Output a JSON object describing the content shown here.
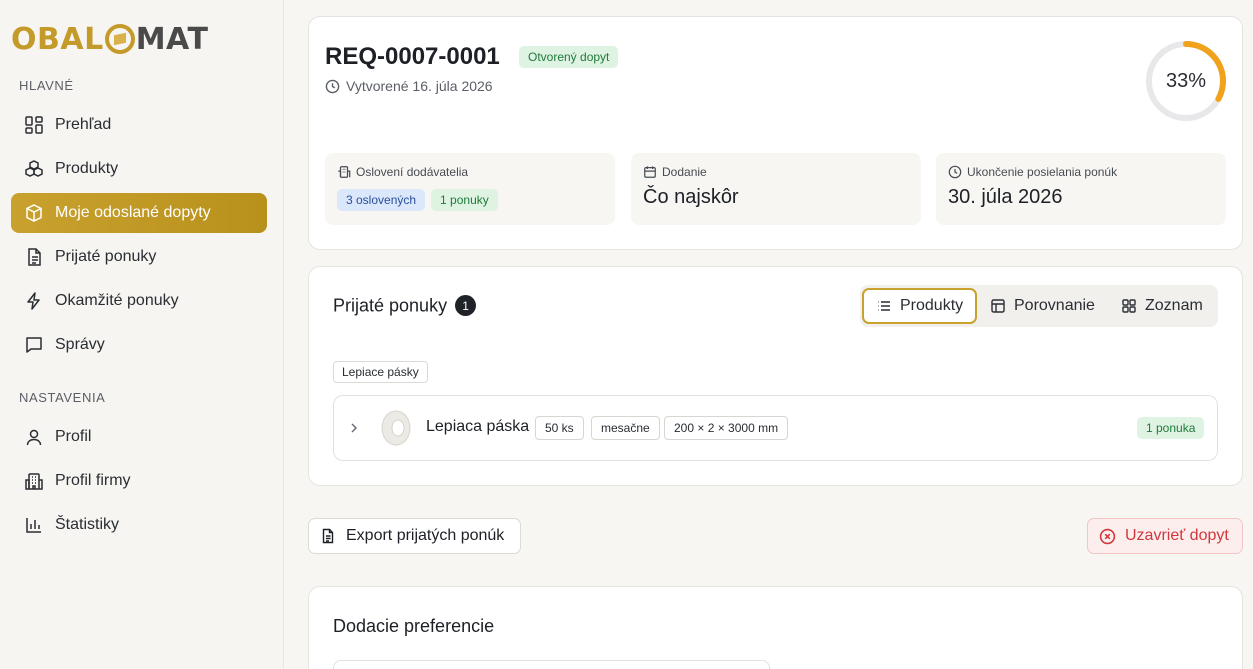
{
  "brand": {
    "logo_left": "OBAL",
    "logo_right": "MAT"
  },
  "sidebar": {
    "section_main": "HLAVNÉ",
    "section_settings": "NASTAVENIA",
    "items": [
      {
        "label": "Prehľad",
        "icon": "dashboard-icon"
      },
      {
        "label": "Produkty",
        "icon": "boxes-icon"
      },
      {
        "label": "Moje odoslané dopyty",
        "icon": "package-send-icon",
        "active": true
      },
      {
        "label": "Prijaté ponuky",
        "icon": "document-icon"
      },
      {
        "label": "Okamžité ponuky",
        "icon": "lightning-icon"
      },
      {
        "label": "Správy",
        "icon": "message-icon"
      }
    ],
    "settings_items": [
      {
        "label": "Profil",
        "icon": "user-icon"
      },
      {
        "label": "Profil firmy",
        "icon": "building-icon"
      },
      {
        "label": "Štatistiky",
        "icon": "bar-chart-icon"
      }
    ]
  },
  "request": {
    "id": "REQ-0007-0001",
    "status": "Otvorený dopyt",
    "created": "Vytvorené 16. júla 2026",
    "progress_percent": 33,
    "progress_label": "33%",
    "accent_color": "#f0a21a",
    "suppliers": {
      "label": "Oslovení dodávatelia",
      "contacted": "3 oslovených",
      "offers": "1 ponuky"
    },
    "delivery": {
      "label": "Dodanie",
      "value": "Čo najskôr"
    },
    "deadline": {
      "label": "Ukončenie posielania ponúk",
      "value": "30. júla 2026"
    }
  },
  "offers": {
    "title": "Prijaté ponuky",
    "count": "1",
    "views": [
      "Produkty",
      "Porovnanie",
      "Zoznam"
    ],
    "active_view": "Produkty",
    "category": "Lepiace pásky",
    "product": {
      "name": "Lepiaca páska",
      "quantity": "50 ks",
      "frequency": "mesačne",
      "dimensions": "200 × 2 × 3000 mm",
      "offers_badge": "1 ponuka"
    }
  },
  "actions": {
    "export": "Export prijatých ponúk",
    "close": "Uzavrieť dopyt"
  },
  "delivery_prefs": {
    "title": "Dodacie preferencie"
  }
}
